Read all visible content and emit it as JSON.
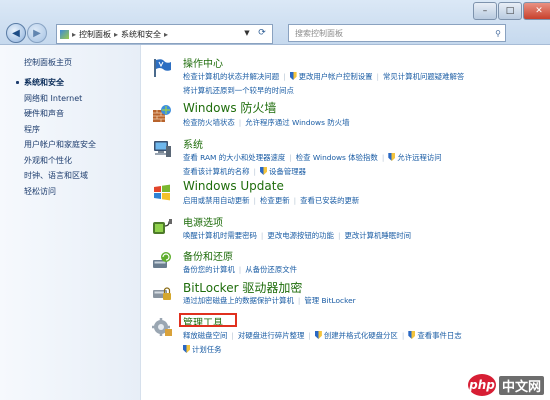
{
  "address": {
    "crumb1": "控制面板",
    "crumb2": "系统和安全"
  },
  "search": {
    "placeholder": "搜索控制面板"
  },
  "sidebar": {
    "home": "控制面板主页",
    "items": [
      {
        "label": "系统和安全",
        "current": true
      },
      {
        "label": "网络和 Internet",
        "current": false
      },
      {
        "label": "硬件和声音",
        "current": false
      },
      {
        "label": "程序",
        "current": false
      },
      {
        "label": "用户帐户和家庭安全",
        "current": false
      },
      {
        "label": "外观和个性化",
        "current": false
      },
      {
        "label": "时钟、语言和区域",
        "current": false
      },
      {
        "label": "轻松访问",
        "current": false
      }
    ]
  },
  "categories": {
    "action_center": {
      "title": "操作中心",
      "line1": [
        "检查计算机的状态并解决问题",
        "更改用户帐户控制设置",
        "常见计算机问题疑难解答"
      ],
      "line2": [
        "将计算机还原到一个较早的时间点"
      ]
    },
    "firewall": {
      "title": "Windows 防火墙",
      "line1": [
        "检查防火墙状态",
        "允许程序通过 Windows 防火墙"
      ]
    },
    "system": {
      "title": "系统",
      "line1": [
        "查看 RAM 的大小和处理器速度",
        "检查 Windows 体验指数",
        "允许远程访问"
      ],
      "line2": [
        "查看该计算机的名称",
        "设备管理器"
      ]
    },
    "update": {
      "title": "Windows Update",
      "line1": [
        "启用或禁用自动更新",
        "检查更新",
        "查看已安装的更新"
      ]
    },
    "power": {
      "title": "电源选项",
      "line1": [
        "唤醒计算机时需要密码",
        "更改电源按钮的功能",
        "更改计算机睡眠时间"
      ]
    },
    "backup": {
      "title": "备份和还原",
      "line1": [
        "备份您的计算机",
        "从备份还原文件"
      ]
    },
    "bitlocker": {
      "title": "BitLocker 驱动器加密",
      "line1": [
        "通过加密磁盘上的数据保护计算机",
        "管理 BitLocker"
      ]
    },
    "admin_tools": {
      "title": "管理工具",
      "line1": [
        "释放磁盘空间",
        "对硬盘进行碎片整理",
        "创建并格式化硬盘分区",
        "查看事件日志"
      ],
      "line2": [
        "计划任务"
      ]
    }
  },
  "watermark": {
    "logo": "php",
    "text": "中文网"
  },
  "colors": {
    "category_title": "#1f6d0c",
    "link": "#1a5ca4",
    "highlight_box": "#e0301e"
  }
}
